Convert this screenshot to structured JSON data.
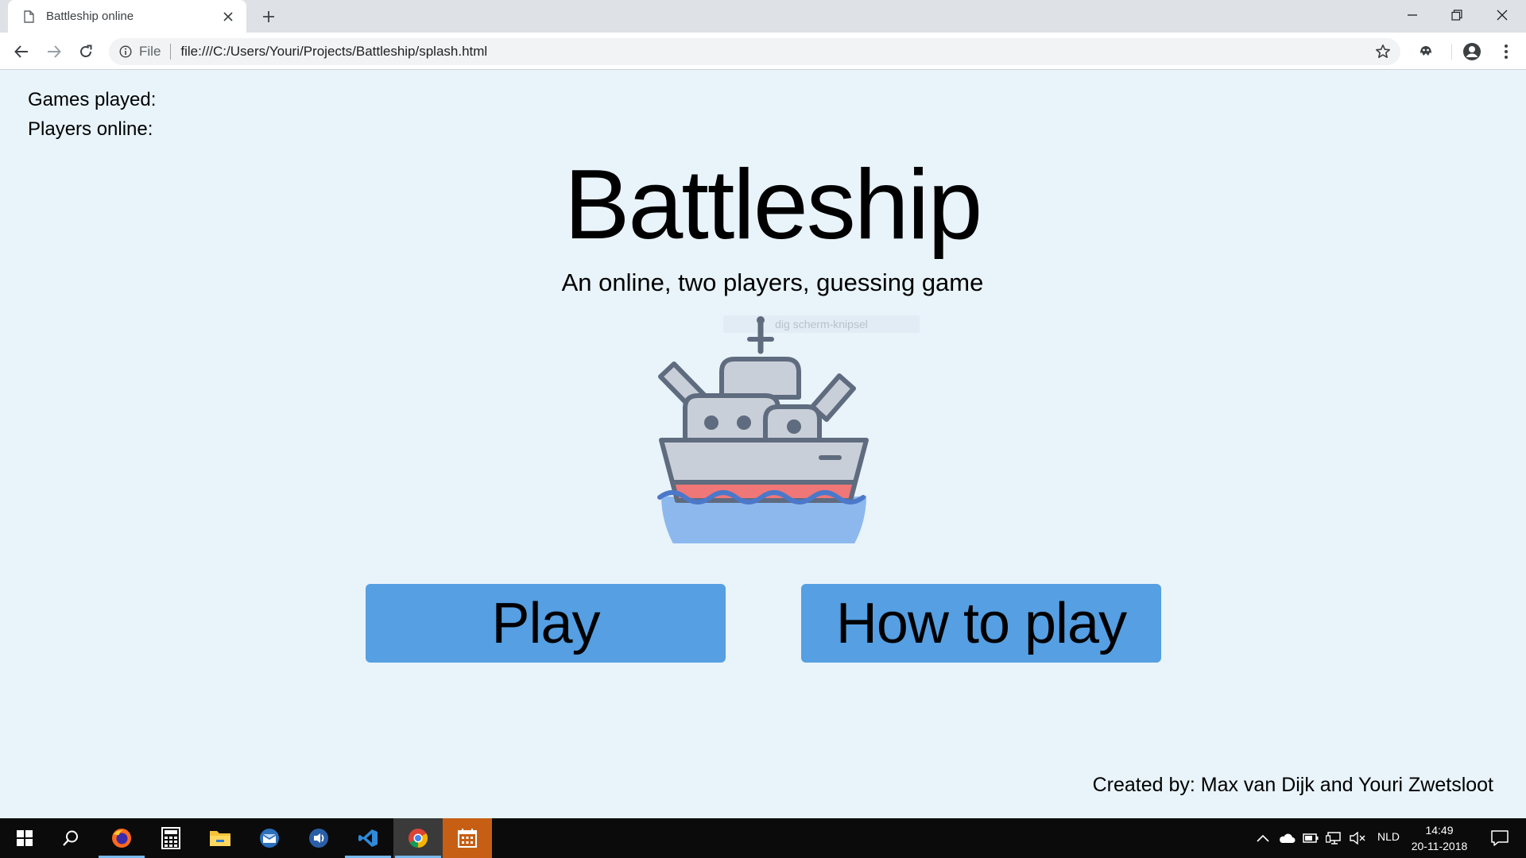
{
  "browser": {
    "tab_title": "Battleship online",
    "scheme_label": "File",
    "url": "file:///C:/Users/Youri/Projects/Battleship/splash.html"
  },
  "page": {
    "stats": {
      "games_played_label": "Games played:",
      "players_online_label": "Players online:"
    },
    "title": "Battleship",
    "subtitle": "An online, two players, guessing game",
    "overlay_text": "dig scherm-knipsel",
    "buttons": {
      "play": "Play",
      "how_to_play": "How to play"
    },
    "credits": "Created by: Max van Dijk and Youri Zwetsloot",
    "colors": {
      "background": "#e8f3fa",
      "button": "#559fe2",
      "ship_hull": "#c9cfd8",
      "ship_outline": "#5f6b7e",
      "ship_stripe": "#ef7777",
      "water": "#8cb8ee"
    }
  },
  "taskbar": {
    "apps": [
      "windows-start",
      "search",
      "firefox",
      "calculator",
      "file-explorer",
      "mail",
      "teamspeak",
      "vscode",
      "chrome",
      "calendar"
    ],
    "language": "NLD",
    "time": "14:49",
    "date": "20-11-2018"
  }
}
